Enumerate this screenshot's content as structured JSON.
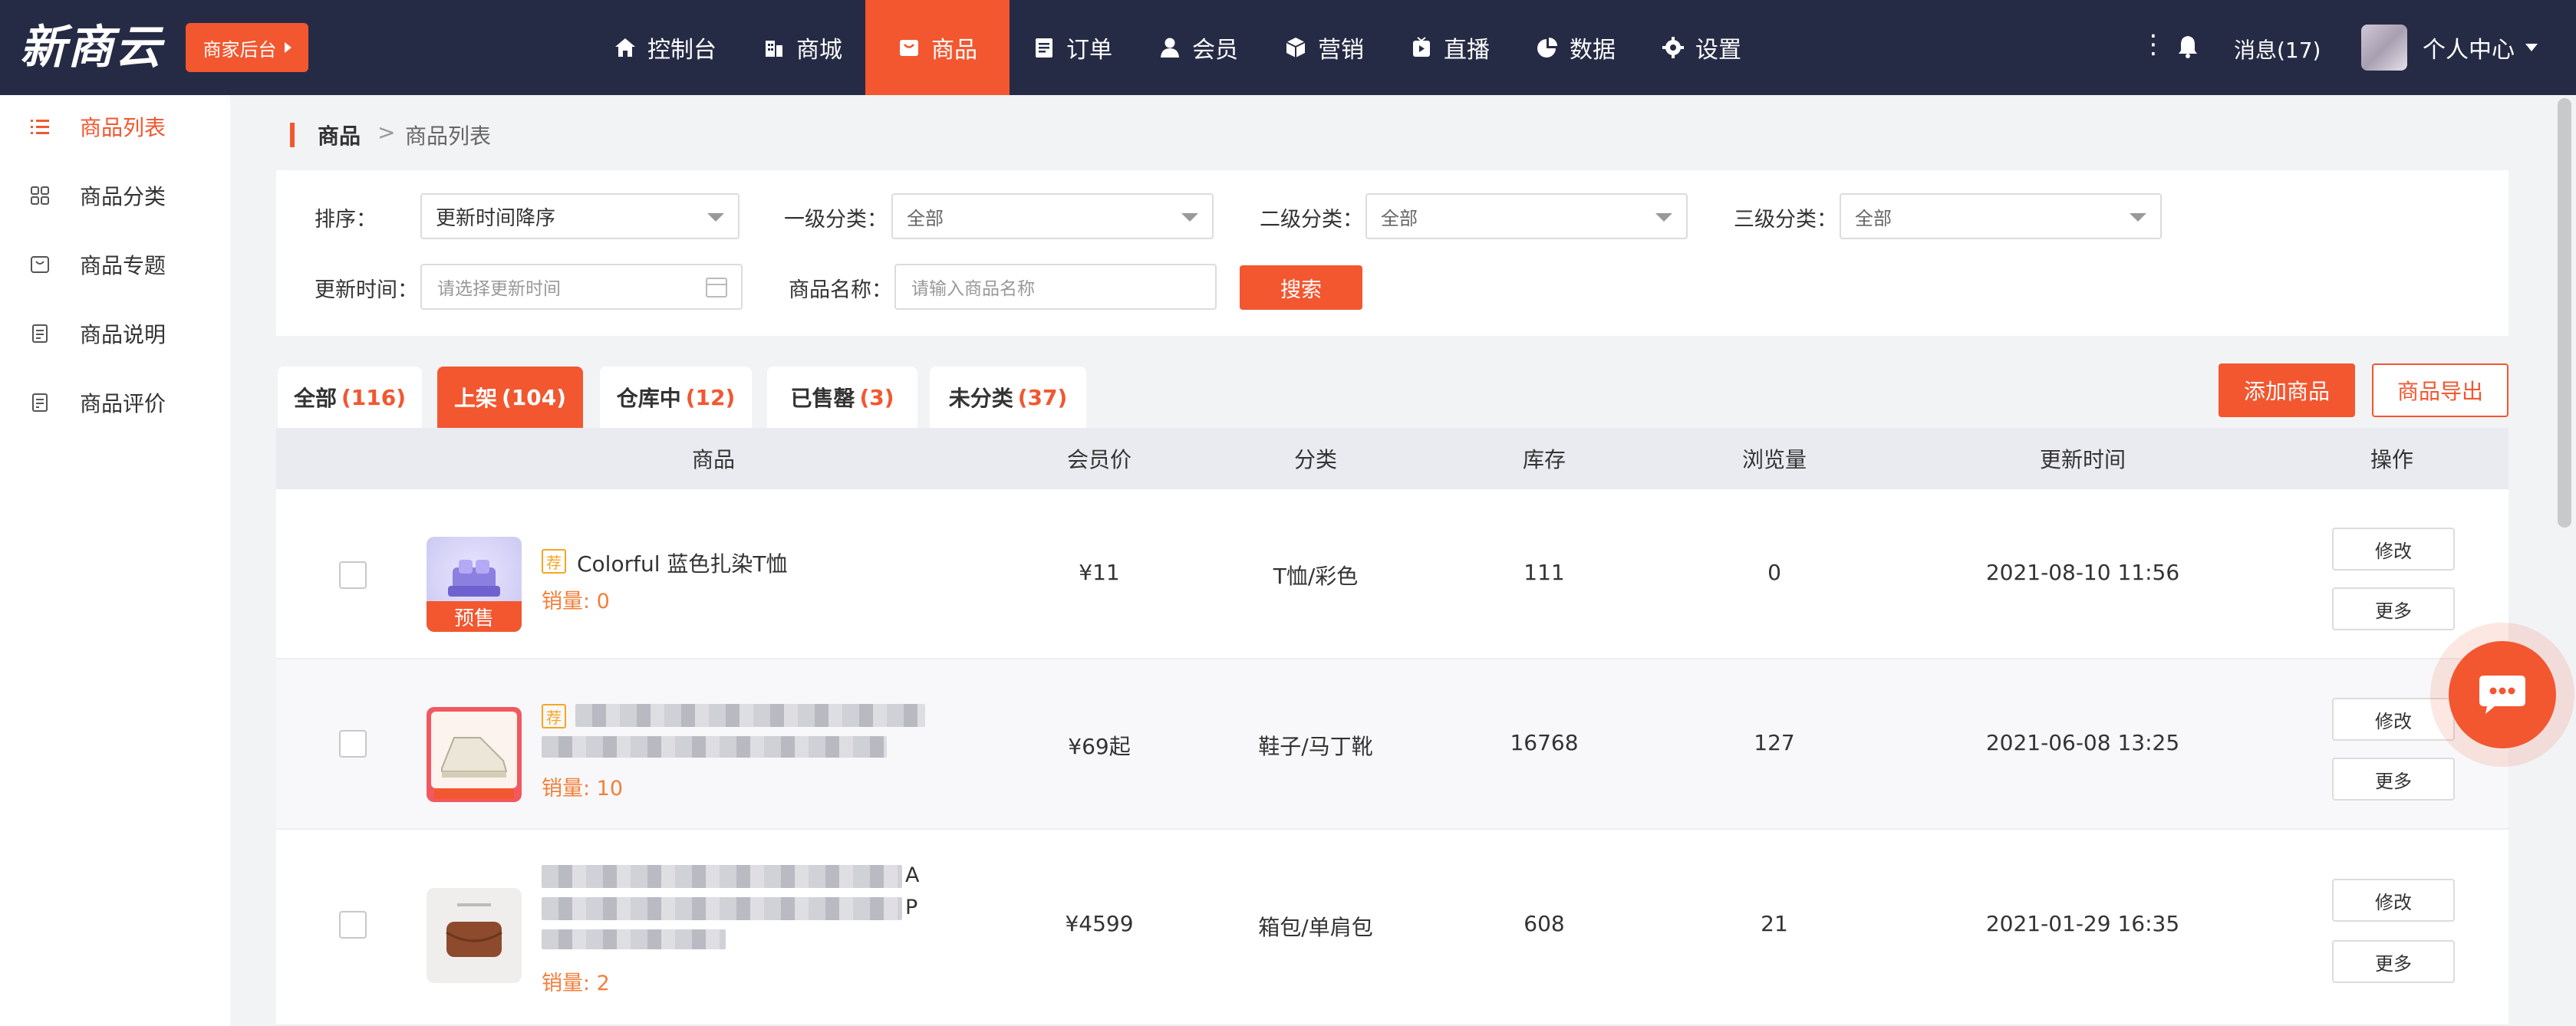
{
  "brand": {
    "logo": "新商云",
    "merchant_button": "商家后台"
  },
  "nav": {
    "items": [
      {
        "label": "控制台",
        "icon": "home-icon"
      },
      {
        "label": "商城",
        "icon": "building-icon"
      },
      {
        "label": "商品",
        "icon": "bag-icon",
        "active": true
      },
      {
        "label": "订单",
        "icon": "order-icon"
      },
      {
        "label": "会员",
        "icon": "user-icon"
      },
      {
        "label": "营销",
        "icon": "cube-icon"
      },
      {
        "label": "直播",
        "icon": "live-icon"
      },
      {
        "label": "数据",
        "icon": "pie-chart-icon"
      },
      {
        "label": "设置",
        "icon": "gear-icon"
      }
    ],
    "messages": "消息(17)",
    "personal": "个人中心"
  },
  "sidebar": {
    "items": [
      {
        "label": "商品列表",
        "icon": "list-icon",
        "active": true
      },
      {
        "label": "商品分类",
        "icon": "grid-icon"
      },
      {
        "label": "商品专题",
        "icon": "topic-icon"
      },
      {
        "label": "商品说明",
        "icon": "document-icon"
      },
      {
        "label": "商品评价",
        "icon": "review-icon"
      }
    ]
  },
  "breadcrumb": {
    "root": "商品",
    "separator": ">",
    "current": "商品列表"
  },
  "filters": {
    "sort_label": "排序：",
    "sort_value": "更新时间降序",
    "cat1_label": "一级分类：",
    "cat1_value": "全部",
    "cat2_label": "二级分类：",
    "cat2_value": "全部",
    "cat3_label": "三级分类：",
    "cat3_value": "全部",
    "time_label": "更新时间：",
    "time_placeholder": "请选择更新时间",
    "name_label": "商品名称：",
    "name_placeholder": "请输入商品名称",
    "search_button": "搜索"
  },
  "tabs": [
    {
      "label": "全部",
      "count": "(116)"
    },
    {
      "label": "上架",
      "count": "(104)",
      "active": true
    },
    {
      "label": "仓库中",
      "count": "(12)"
    },
    {
      "label": "已售罄",
      "count": "(3)"
    },
    {
      "label": "未分类",
      "count": "(37)"
    }
  ],
  "actions": {
    "add": "添加商品",
    "export": "商品导出"
  },
  "table": {
    "headers": [
      "商品",
      "会员价",
      "分类",
      "库存",
      "浏览量",
      "更新时间",
      "操作"
    ],
    "rows": [
      {
        "recommend": "荐",
        "name": "Colorful 蓝色扎染T恤",
        "badge": "预售",
        "sales": "销量: 0",
        "price": "¥11",
        "category": "T恤/彩色",
        "stock": "111",
        "views": "0",
        "updated": "2021-08-10 11:56",
        "edit": "修改",
        "more": "更多"
      },
      {
        "recommend": "荐",
        "name": "",
        "badge": "",
        "sales": "销量: 10",
        "price": "¥69起",
        "category": "鞋子/马丁靴",
        "stock": "16768",
        "views": "127",
        "updated": "2021-06-08 13:25",
        "edit": "修改",
        "more": "更多"
      },
      {
        "recommend": "",
        "name_tail_1": "A",
        "name_tail_2": "P",
        "badge": "",
        "sales": "销量: 2",
        "price": "¥4599",
        "category": "箱包/单肩包",
        "stock": "608",
        "views": "21",
        "updated": "2021-01-29 16:35",
        "edit": "修改",
        "more": "更多"
      }
    ]
  },
  "colors": {
    "accent": "#f25730",
    "topbar": "#262b45",
    "sales": "#f27f3b",
    "recommend": "#f5a623"
  }
}
